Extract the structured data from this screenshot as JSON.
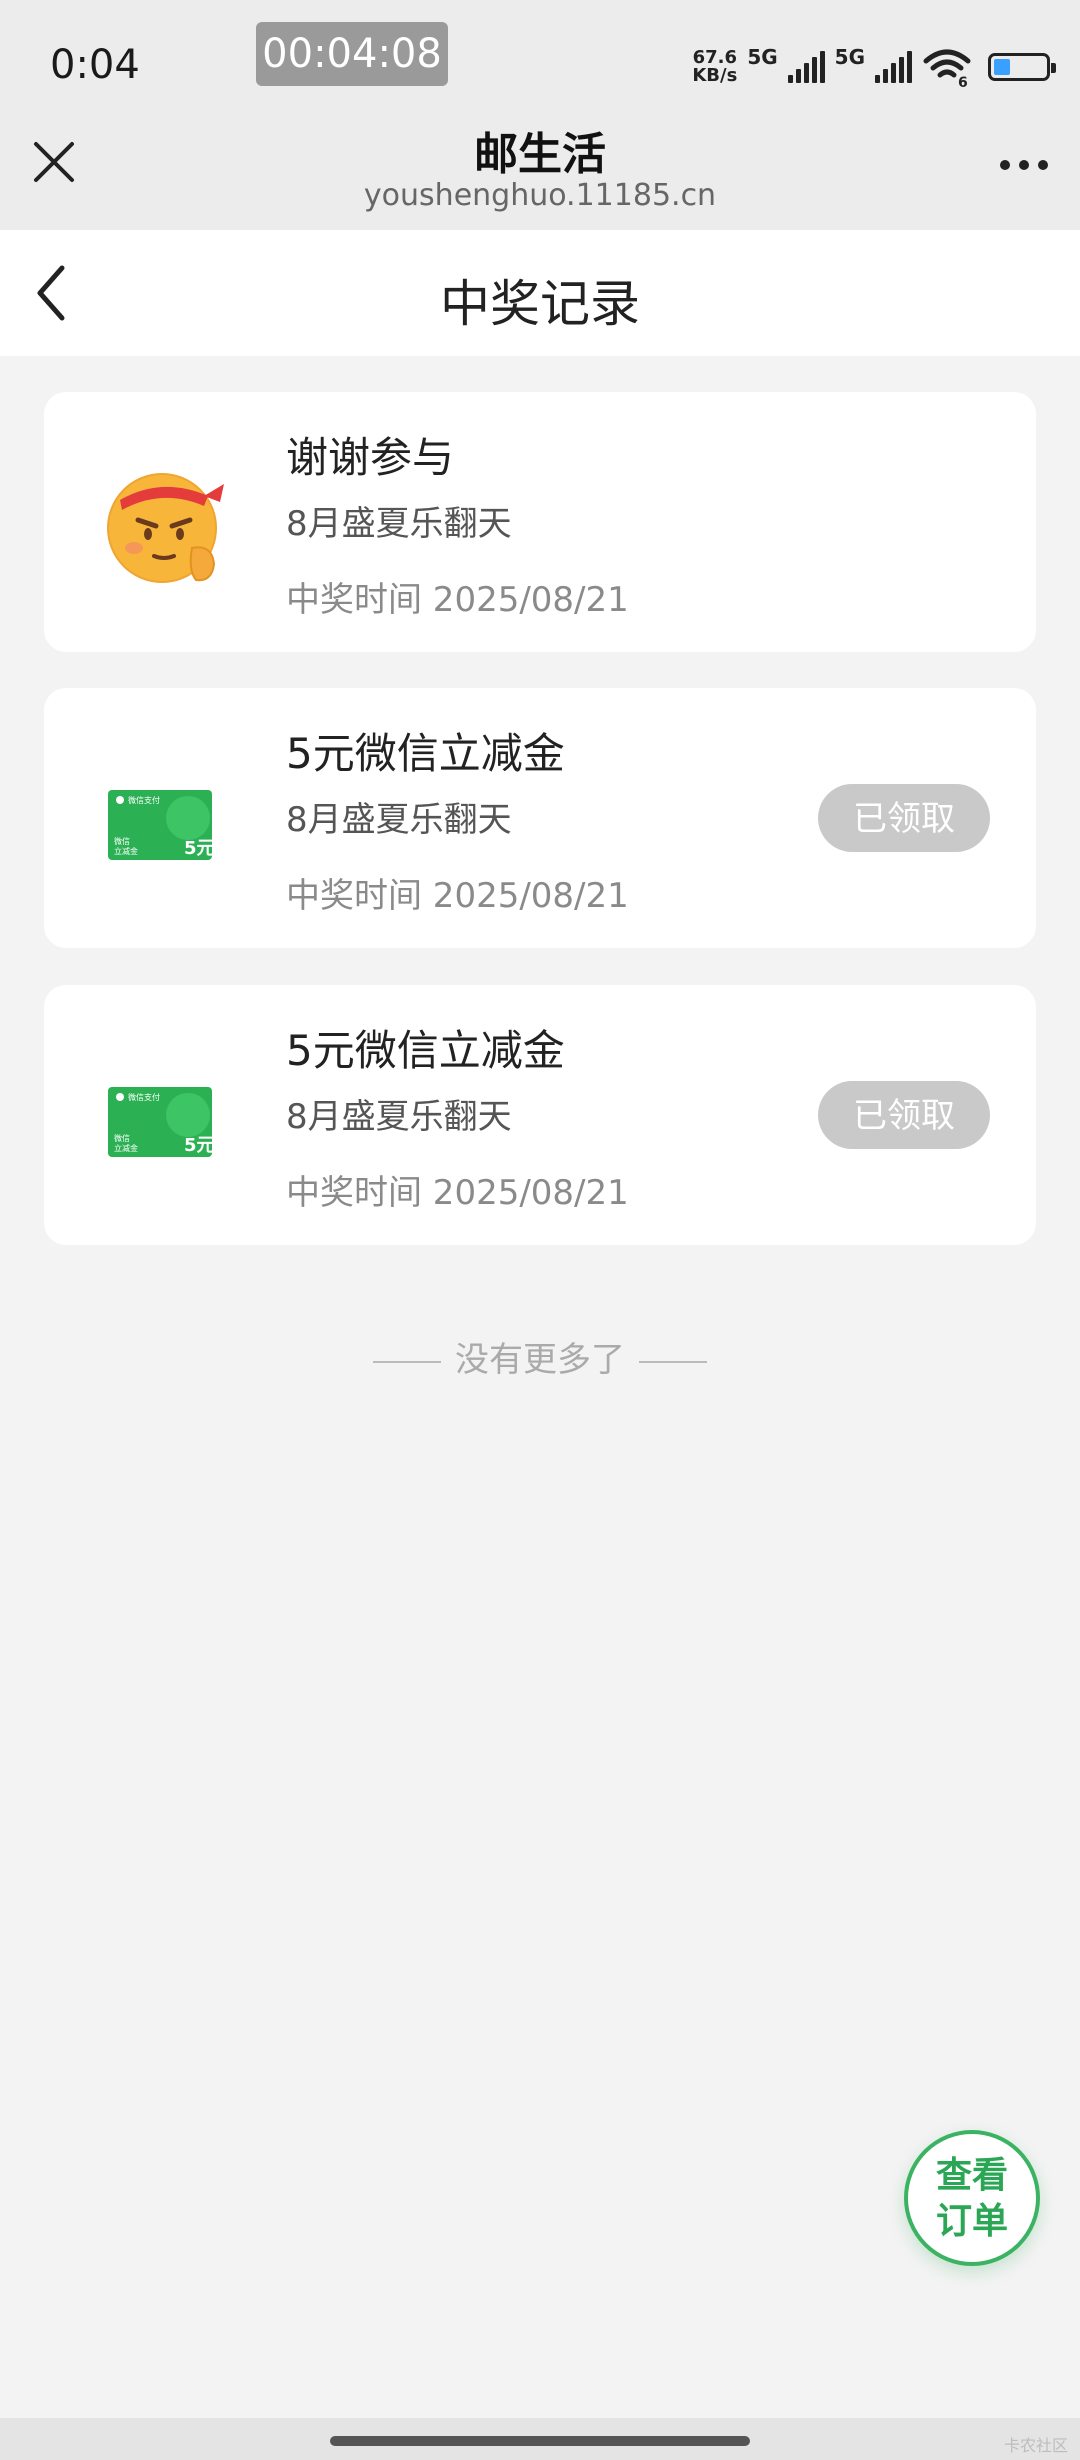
{
  "status_bar": {
    "time": "0:04",
    "recording_timer": "00:04:08",
    "net_speed_value": "67.6",
    "net_speed_unit": "KB/s",
    "network_1": "5G",
    "network_2": "5G",
    "wifi_label": "6",
    "battery_level": 0.4
  },
  "browser": {
    "title": "邮生活",
    "url": "youshenghuo.11185.cn"
  },
  "page": {
    "title": "中奖记录"
  },
  "records": [
    {
      "name": "谢谢参与",
      "activity": "8月盛夏乐翻天",
      "time": "中奖时间 2025/08/21",
      "icon": "smirk-emoji-icon",
      "button": ""
    },
    {
      "name": "5元微信立减金",
      "activity": "8月盛夏乐翻天",
      "time": "中奖时间 2025/08/21",
      "icon": "wechat-pay-card-icon",
      "button": "已领取"
    },
    {
      "name": "5元微信立减金",
      "activity": "8月盛夏乐翻天",
      "time": "中奖时间 2025/08/21",
      "icon": "wechat-pay-card-icon",
      "button": "已领取"
    }
  ],
  "coupon_card": {
    "brand": "微信支付",
    "label": "微信\n立减金",
    "amount": "5元"
  },
  "no_more": "没有更多了",
  "fab": {
    "line1": "查看",
    "line2": "订单"
  },
  "watermark": "卡农社区",
  "colors": {
    "accent_green": "#3bb363",
    "button_gray": "#c9c9c9",
    "page_bg": "#f3f3f3"
  }
}
